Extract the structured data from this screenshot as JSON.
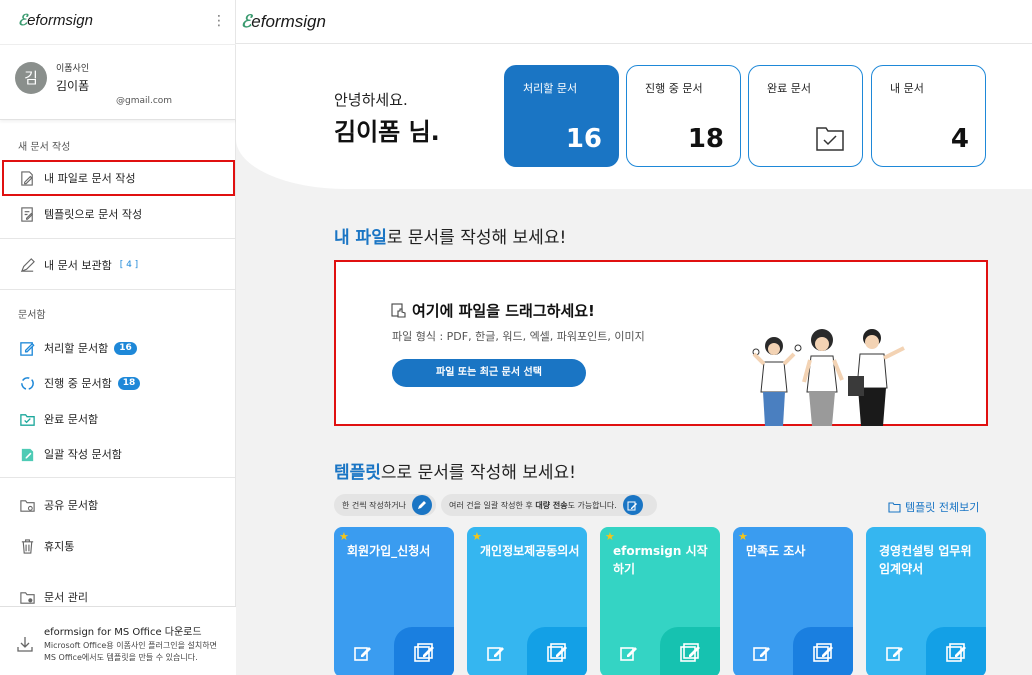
{
  "brand": {
    "mark": "ℰ",
    "name": "eformsign"
  },
  "profile": {
    "avatar_initial": "김",
    "company": "이폼사인",
    "name": "김이폼",
    "email": "@gmail.com"
  },
  "sidebar": {
    "new_doc_section": "새 문서 작성",
    "new_from_file": "내 파일로 문서 작성",
    "new_from_template": "템플릿으로 문서 작성",
    "my_storage": "내 문서 보관함",
    "my_storage_count": "[ 4 ]",
    "docbox_section": "문서함",
    "action_required": "처리할 문서함",
    "action_required_count": "16",
    "in_progress": "진행 중 문서함",
    "in_progress_count": "18",
    "completed": "완료 문서함",
    "bulk": "일괄 작성 문서함",
    "shared": "공유 문서함",
    "trash": "휴지통",
    "manage": "문서 관리",
    "footer_title": "eformsign for MS Office 다운로드",
    "footer_desc_1": "Microsoft Office용 이폼사인 플러그인을 설치하면",
    "footer_desc_2": "MS Office에서도 템플릿을 만들 수 있습니다."
  },
  "header": {
    "greeting": "안녕하세요.",
    "user_title": "김이폼 님.",
    "cards": [
      {
        "label": "처리할 문서",
        "value": "16"
      },
      {
        "label": "진행 중 문서",
        "value": "18"
      },
      {
        "label": "완료 문서",
        "icon": "folder-check-icon"
      },
      {
        "label": "내 문서",
        "value": "4"
      }
    ]
  },
  "file_section": {
    "heading_highlight": "내 파일",
    "heading_rest": "로 문서를 작성해 보세요!",
    "drop_title": "여기에 파일을 드래그하세요!",
    "formats": "파일 형식 : PDF, 한글, 워드, 엑셀, 파워포인트, 이미지",
    "button": "파일 또는 최근 문서 선택"
  },
  "template_section": {
    "heading_highlight": "템플릿",
    "heading_rest": "으로 문서를 작성해 보세요!",
    "hint_single": "한 건씩 작성하거나",
    "hint_bulk_pre": "여러 건을 일괄 작성한 후 ",
    "hint_bulk_bold": "대량 전송",
    "hint_bulk_post": "도 가능합니다.",
    "view_all": "템플릿 전체보기",
    "templates": [
      {
        "title": "회원가입_신청서",
        "star": "★",
        "color": "#3a9cf0",
        "dark": "#1a7fe0"
      },
      {
        "title": "개인정보제공동의서",
        "star": "★",
        "color": "#35b6f0",
        "dark": "#13a0e6"
      },
      {
        "title": "eformsign 시작하기",
        "star": "★",
        "color": "#34d4c4",
        "dark": "#16c2b0"
      },
      {
        "title": "만족도 조사",
        "star": "★",
        "color": "#3a9cf0",
        "dark": "#1a7fe0"
      },
      {
        "title": "경영컨설팅 업무위임계약서",
        "star": "",
        "color": "#35b6f0",
        "dark": "#13a0e6"
      }
    ]
  },
  "colors": {
    "accent": "#1a75c4",
    "highlight_border": "#e01010",
    "badge": "#1e88d8"
  }
}
